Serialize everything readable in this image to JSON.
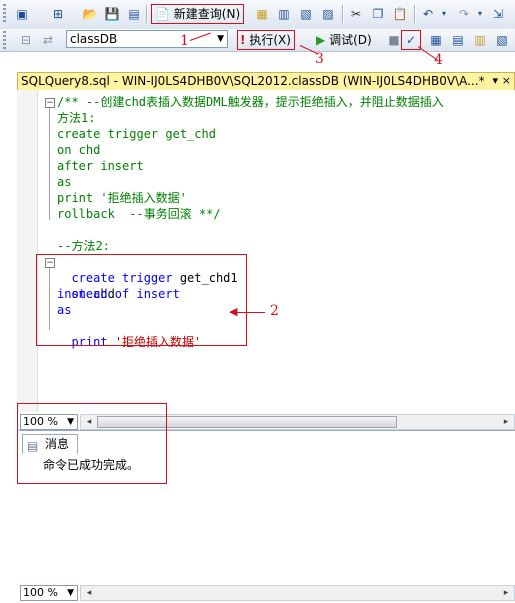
{
  "toolbar1": {
    "new_query_label": "新建查询(N)"
  },
  "toolbar2": {
    "database": "classDB",
    "execute_label": "执行(X)",
    "debug_label": "调试(D)"
  },
  "document": {
    "tab_title": "SQLQuery8.sql - WIN-IJ0LS4DHB0V\\SQL2012.classDB (WIN-IJ0LS4DHB0V\\A...*"
  },
  "editor": {
    "lines": [
      "/** --创建chd表插入数据DML触发器，提示拒绝插入，并阻止数据插入",
      "方法1:",
      "create trigger get_chd",
      "on chd",
      "after insert",
      "as",
      "print '拒绝插入数据'",
      "rollback  --事务回滚 **/",
      "",
      "--方法2:",
      "create trigger get_chd1",
      "on chd",
      "instead of insert",
      "as",
      "print '拒绝插入数据'"
    ],
    "line2_parts": [
      "create trigger ",
      "get_chd1"
    ],
    "line3_parts": [
      "on ",
      "chd"
    ],
    "line4_parts": [
      "instead of insert"
    ],
    "line6_parts": [
      "print ",
      "'拒绝插入数据'"
    ]
  },
  "zoom": {
    "editor_zoom": "100 %",
    "results_zoom": "100 %"
  },
  "results": {
    "tab_label": "消息",
    "message": "命令已成功完成。"
  },
  "annotations": [
    "1",
    "2",
    "3",
    "4"
  ],
  "colors": {
    "annotation": "#d2121a",
    "keyword": "#0000ff",
    "comment": "#008000",
    "string": "#c00000",
    "tab_active": "#fff3a1"
  }
}
